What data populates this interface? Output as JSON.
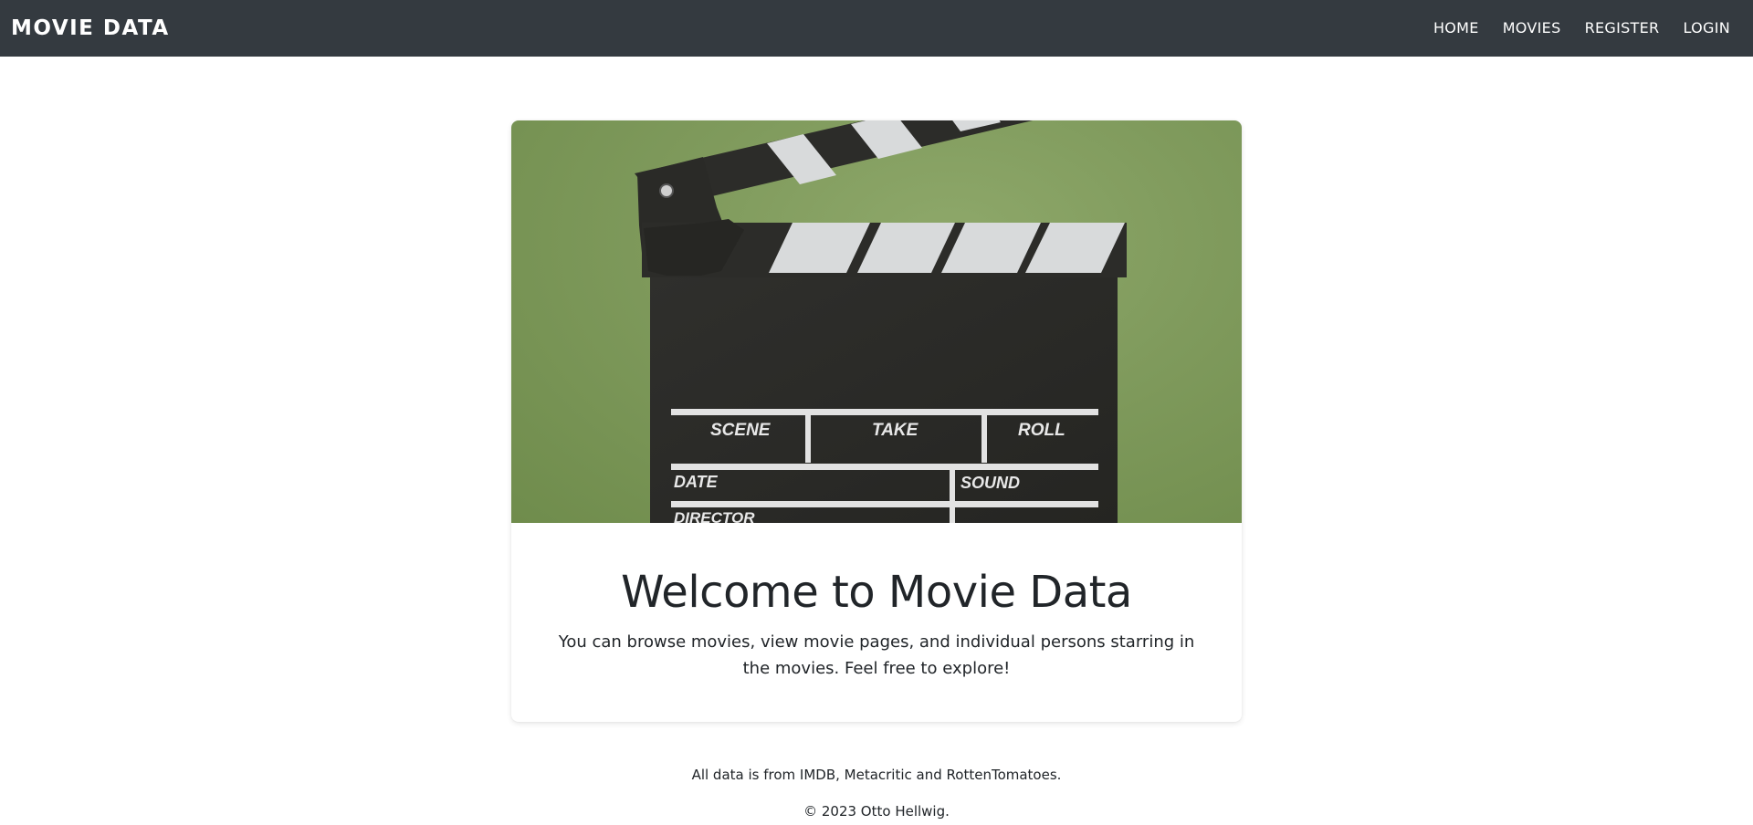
{
  "navbar": {
    "brand": "MOVIE DATA",
    "links": [
      {
        "label": "HOME"
      },
      {
        "label": "MOVIES"
      },
      {
        "label": "REGISTER"
      },
      {
        "label": "LOGIN"
      }
    ]
  },
  "hero": {
    "slate_labels": {
      "scene": "SCENE",
      "take": "TAKE",
      "roll": "ROLL",
      "date": "DATE",
      "sound": "SOUND",
      "director": "DIRECTOR"
    }
  },
  "main": {
    "title": "Welcome to Movie Data",
    "description": "You can browse movies, view movie pages, and individual persons starring in the movies. Feel free to explore!"
  },
  "footer": {
    "sources": "All data is from IMDB, Metacritic and RottenTomatoes.",
    "copyright": "© 2023 Otto Hellwig."
  },
  "colors": {
    "navbar_bg": "#343a40",
    "hero_green": "#7f9a5c",
    "slate_black": "#2a2a27"
  }
}
